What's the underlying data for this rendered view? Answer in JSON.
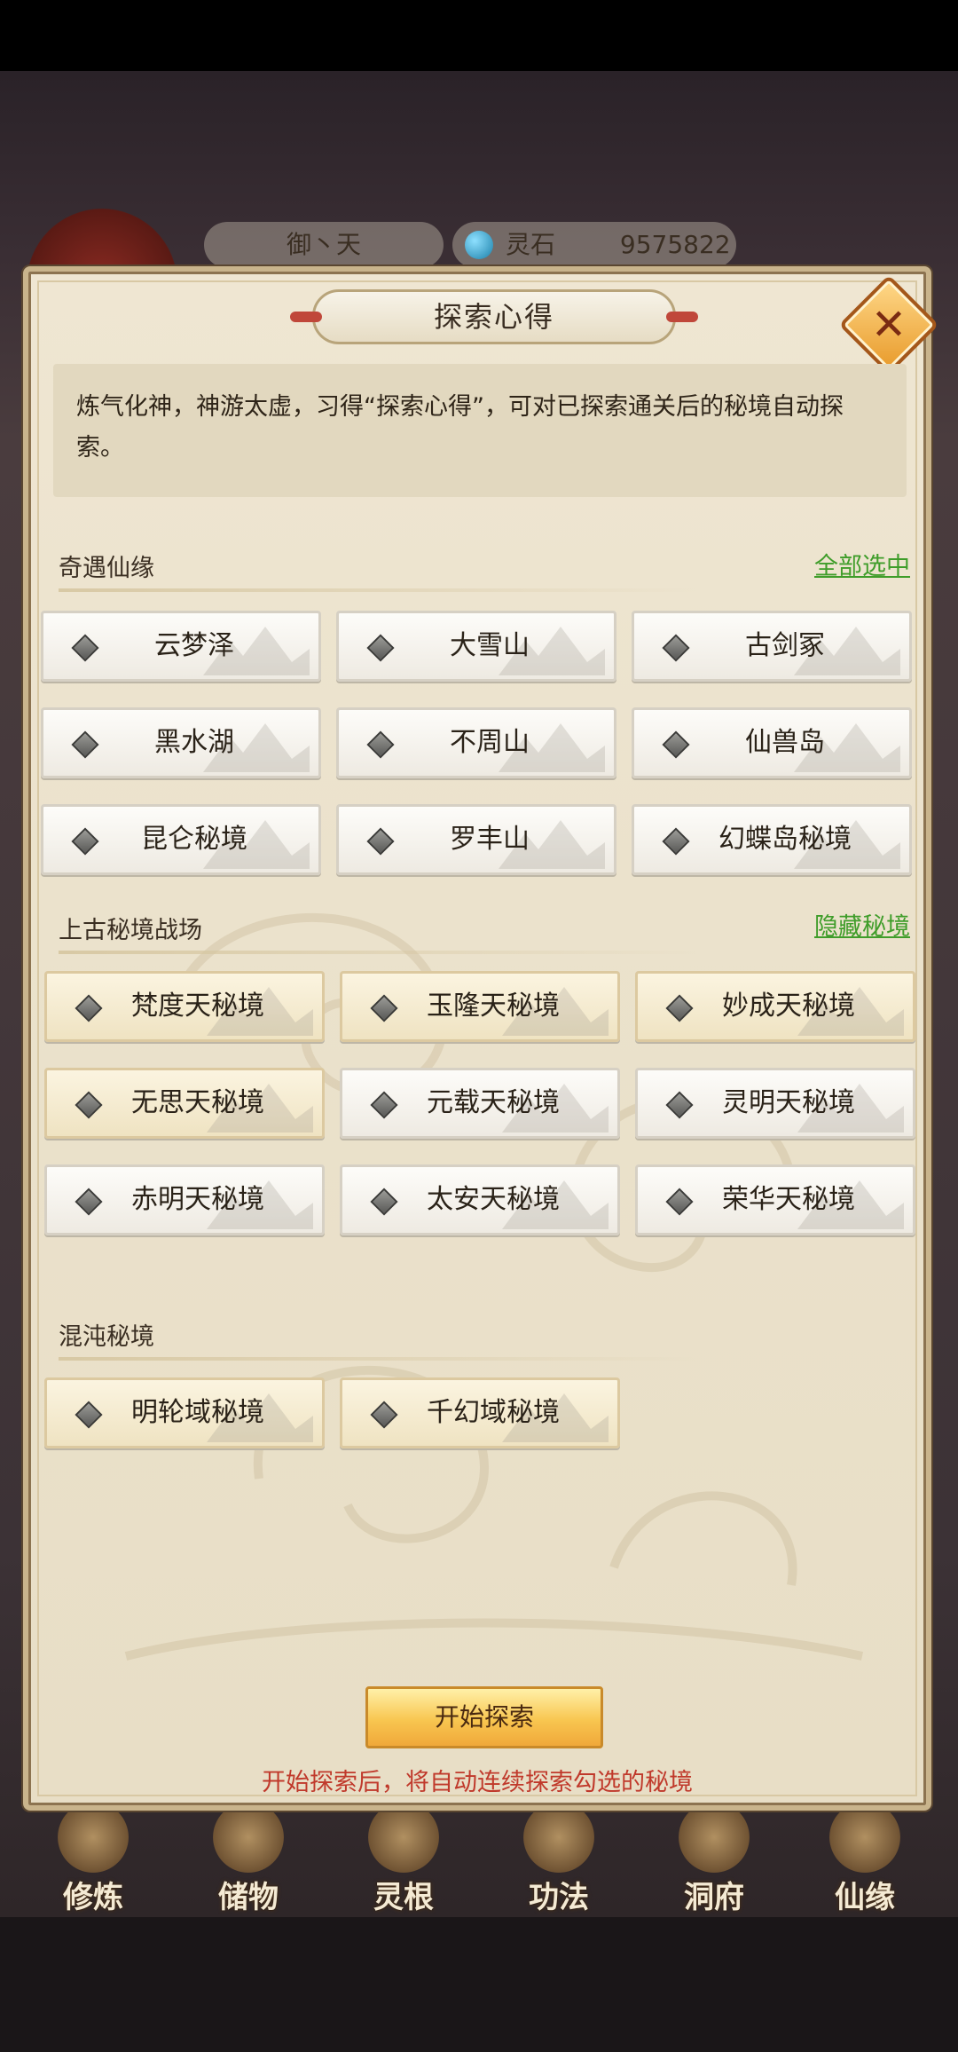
{
  "hud": {
    "name": "御丶天",
    "stone_label": "灵石",
    "stone_value": "9575822"
  },
  "dialog": {
    "title": "探索心得",
    "close_symbol": "✕",
    "intro": "炼气化神，神游太虚，习得“探索心得”，可对已探索通关后的秘境自动探索。",
    "sections": [
      {
        "label": "奇遇仙缘",
        "link": "全部选中",
        "items": [
          "云梦泽",
          "大雪山",
          "古剑冢",
          "黑水湖",
          "不周山",
          "仙兽岛",
          "昆仑秘境",
          "罗丰山",
          "幻蝶岛秘境"
        ]
      },
      {
        "label": "上古秘境战场",
        "link": "隐藏秘境",
        "items": [
          "梵度天秘境",
          "玉隆天秘境",
          "妙成天秘境",
          "无思天秘境",
          "元载天秘境",
          "灵明天秘境",
          "赤明天秘境",
          "太安天秘境",
          "荣华天秘境"
        ]
      },
      {
        "label": "混沌秘境",
        "link": "",
        "items": [
          "明轮域秘境",
          "千幻域秘境"
        ]
      }
    ],
    "start_button": "开始探索",
    "hint": "开始探索后，将自动连续探索勾选的秘境"
  },
  "nav": {
    "items": [
      "修炼",
      "储物",
      "灵根",
      "功法",
      "洞府",
      "仙缘"
    ]
  }
}
